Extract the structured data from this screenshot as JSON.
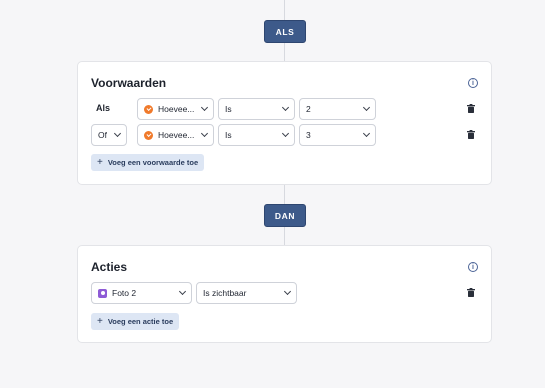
{
  "if_label": "ALS",
  "then_label": "DAN",
  "conditions": {
    "title": "Voorwaarden",
    "rows": [
      {
        "connector": "Als",
        "connector_is_select": false,
        "field": "Hoevee...",
        "operator": "Is",
        "value": "2"
      },
      {
        "connector": "Of",
        "connector_is_select": true,
        "field": "Hoevee...",
        "operator": "Is",
        "value": "3"
      }
    ],
    "add_label": "Voeg een voorwaarde toe"
  },
  "actions": {
    "title": "Acties",
    "rows": [
      {
        "target": "Foto 2",
        "action": "Is zichtbaar"
      }
    ],
    "add_label": "Voeg een actie toe"
  },
  "icons": {
    "info": "info-icon",
    "trash": "trash-icon",
    "chevron": "chevron-down-icon",
    "field_badge": "number-field-icon",
    "image_badge": "image-icon",
    "plus": "plus-icon"
  },
  "colors": {
    "pill": "#3d5a8a",
    "accent_orange": "#f07a2b",
    "accent_purple": "#8e5bd6",
    "add_button_bg": "#dde6f4"
  }
}
